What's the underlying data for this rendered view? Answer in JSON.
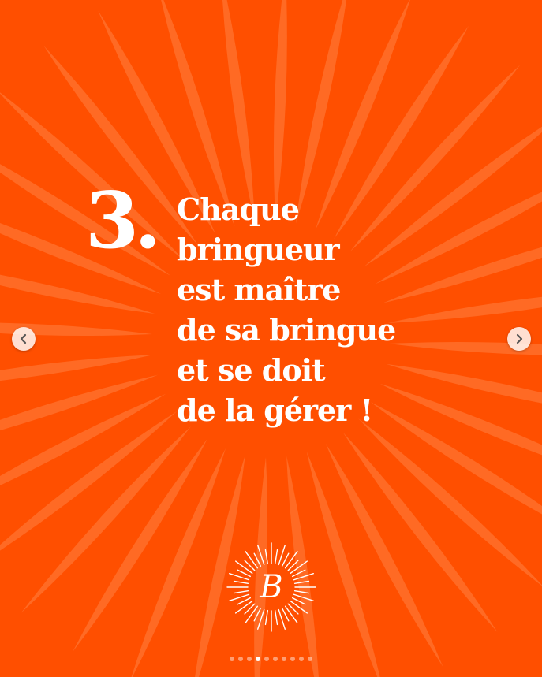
{
  "slide": {
    "background_color": "#ff4f00",
    "number": "3.",
    "headline_lines": [
      "Chaque",
      "bringueur",
      "est maître",
      "de sa bringue",
      "et se doit",
      "de la gérer !"
    ],
    "logo_letter": "B"
  },
  "carousel": {
    "prev_icon": "chevron-left-icon",
    "next_icon": "chevron-right-icon",
    "slide_count": 10,
    "current_slide": 4
  }
}
